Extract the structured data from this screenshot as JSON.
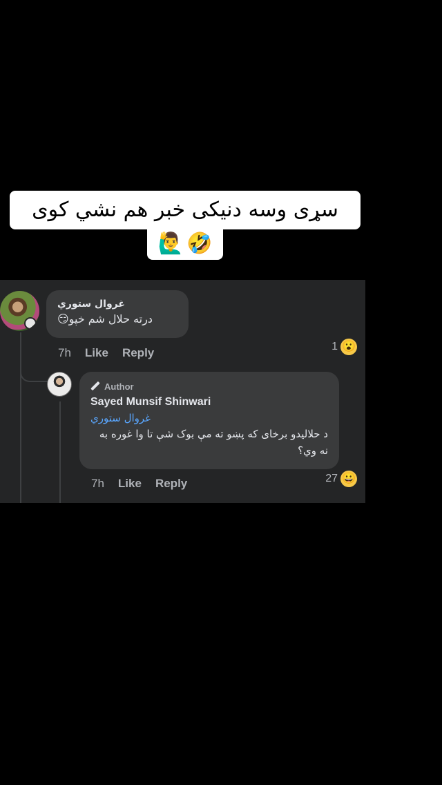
{
  "caption": {
    "line1": "سړی وسه  دنیکی خبر هم نشي کوی",
    "line2_emojis": [
      "🙋‍♂️",
      "🤣"
    ]
  },
  "comments": [
    {
      "author": "غروال ستوري",
      "text": "درته حلال شم خپو😏",
      "time": "7h",
      "like_label": "Like",
      "reply_label": "Reply",
      "reaction_count": "1",
      "reaction_emoji": "😮"
    }
  ],
  "reply": {
    "badge": "Author",
    "author": "Sayed Munsif Shinwari",
    "mention": "غروال ستوري",
    "text": "د حلالیدو برخای که پښو ته مې بوک شې تا وا غوره به نه وي؟",
    "time": "7h",
    "like_label": "Like",
    "reply_label": "Reply",
    "reaction_count": "27",
    "reaction_emoji": "😀"
  },
  "colors": {
    "background": "#000000",
    "panel": "#242526",
    "bubble": "#3a3b3c",
    "mention": "#5aa7ff",
    "muted": "#b0b3b8"
  },
  "icons": [
    "pen-icon",
    "avatar",
    "reaction-emoji"
  ]
}
